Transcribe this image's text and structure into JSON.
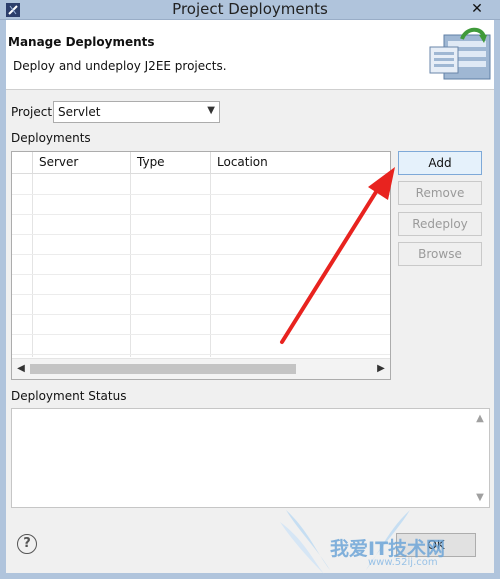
{
  "window": {
    "title": "Project Deployments",
    "close_glyph": "✕"
  },
  "banner": {
    "title": "Manage Deployments",
    "description": "Deploy and undeploy J2EE projects.",
    "icon": "deploy-wizard-icon"
  },
  "project": {
    "label": "Project",
    "selected": "Servlet"
  },
  "deployments": {
    "label": "Deployments",
    "columns": [
      "Server",
      "Type",
      "Location"
    ],
    "rows": []
  },
  "buttons": {
    "add": "Add",
    "remove": "Remove",
    "redeploy": "Redeploy",
    "browse": "Browse"
  },
  "status": {
    "label": "Deployment Status"
  },
  "footer": {
    "help_glyph": "?",
    "ok": "OK"
  },
  "watermark": {
    "text": "我爱IT技术网",
    "url": "www.52ij.com"
  },
  "annotation": {
    "arrow_color": "#e8231f"
  }
}
